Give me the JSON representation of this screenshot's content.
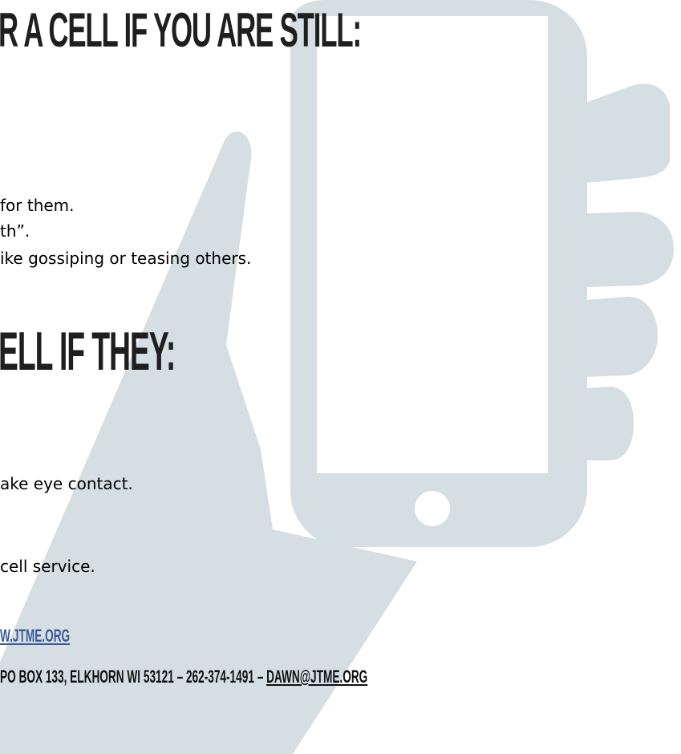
{
  "colors": {
    "illustration": "#d5dfe3",
    "heading_text": "#1f1f1f",
    "body_text": "#000000",
    "link": "#3d5b9a"
  },
  "illustration": {
    "icon": "hand-holding-phone-icon"
  },
  "sections": {
    "first_heading": "R A CELL IF YOU ARE STILL:",
    "first_items": [
      "for them.",
      "th”.",
      "ike gossiping or teasing others."
    ],
    "second_heading": "ELL IF THEY:",
    "second_items": [
      "ake eye contact.",
      "cell service."
    ]
  },
  "footer": {
    "website": "W.JTME.ORG",
    "address": "PO BOX 133, ELKHORN WI 53121 – 262-374-1491 – ",
    "email": "DAWN@JTME.ORG"
  }
}
